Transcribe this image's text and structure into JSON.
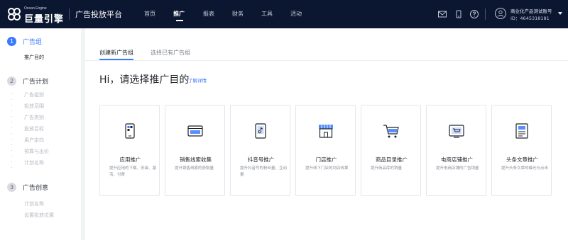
{
  "header": {
    "logo_small": "Ocean Engine",
    "logo_big": "巨量引擎",
    "platform": "广告投放平台",
    "nav": [
      {
        "label": "首页",
        "active": false
      },
      {
        "label": "推广",
        "active": true
      },
      {
        "label": "报表",
        "active": false
      },
      {
        "label": "财务",
        "active": false
      },
      {
        "label": "工具",
        "active": false
      },
      {
        "label": "活动",
        "active": false
      }
    ],
    "icons": [
      "mail-icon",
      "phone-icon",
      "help-icon"
    ],
    "account_name": "商业化产品测试账号",
    "account_id": "ID：4645318181"
  },
  "sidebar": {
    "steps": [
      {
        "num": "1",
        "title": "广告组",
        "status": "active",
        "items": [
          {
            "label": "推广目的",
            "style": "strong"
          }
        ]
      },
      {
        "num": "2",
        "title": "广告计划",
        "status": "normal",
        "items": [
          {
            "label": "广告组别",
            "style": "muted"
          },
          {
            "label": "投放范围",
            "style": "muted"
          },
          {
            "label": "广告类别",
            "style": "muted"
          },
          {
            "label": "投放目标",
            "style": "muted"
          },
          {
            "label": "用户定向",
            "style": "muted"
          },
          {
            "label": "预算与出价",
            "style": "muted"
          },
          {
            "label": "计划名称",
            "style": "muted"
          }
        ]
      },
      {
        "num": "3",
        "title": "广告创意",
        "status": "normal",
        "items": [
          {
            "label": "计划名称",
            "style": "muted"
          },
          {
            "label": "设置投放位置",
            "style": "muted"
          }
        ]
      }
    ]
  },
  "main": {
    "tabs": [
      {
        "label": "创建新广告组",
        "active": true
      },
      {
        "label": "选择已有广告组",
        "active": false
      }
    ],
    "heading": "Hi，请选择推广目的",
    "learn_more": "了解详情",
    "cards": [
      {
        "title": "应用推广",
        "desc": "提升应用的下载、安装、激活、付费",
        "icon": "app-promotion-icon"
      },
      {
        "title": "销售线索收集",
        "desc": "提升销售线索的获取量",
        "icon": "sales-lead-icon"
      },
      {
        "title": "抖音号推广",
        "desc": "提升抖音号的粉丝量、互动量",
        "icon": "douyin-account-icon"
      },
      {
        "title": "门店推广",
        "desc": "提升线下门店的到店效果",
        "icon": "store-icon"
      },
      {
        "title": "商品目录推广",
        "desc": "提升商品库的销量",
        "icon": "shopping-cart-icon"
      },
      {
        "title": "电商店铺推广",
        "desc": "提升电商店铺的广告销量",
        "icon": "ecommerce-store-icon"
      },
      {
        "title": "头条文章推广",
        "desc": "提升头条文章的曝光与点击",
        "icon": "article-icon"
      }
    ]
  },
  "colors": {
    "accent": "#3a7afe",
    "topbar": "#0b1730"
  }
}
